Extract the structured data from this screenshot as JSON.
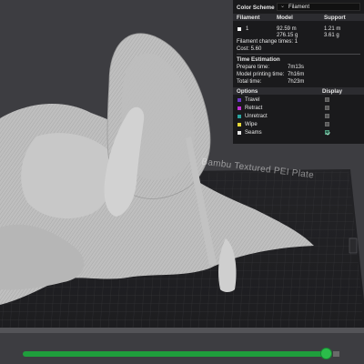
{
  "viewport": {
    "bed_label": "Bambu Textured PEI Plate"
  },
  "panel": {
    "color_scheme_label": "Color Scheme",
    "color_scheme_value": "Filament",
    "filament_table": {
      "headers": [
        "Filament",
        "Model",
        "Support"
      ],
      "rows": [
        {
          "id": "1",
          "model_length": "92.59 m",
          "model_weight": "276.15 g",
          "support_length": "1.21 m",
          "support_weight": "3.61 g",
          "color": "#ffffff"
        }
      ]
    },
    "filament_change_times": "Filament change times:  1",
    "cost": "Cost:  5.60",
    "time_estimation": {
      "title": "Time Estimation",
      "prepare_label": "Prepare time:",
      "prepare_value": "7m13s",
      "printing_label": "Model printing time:",
      "printing_value": "7h16m",
      "total_label": "Total time:",
      "total_value": "7h23m"
    },
    "options": {
      "title": "Options",
      "display_title": "Display",
      "items": [
        {
          "label": "Travel",
          "color": "#6b39c4",
          "checked": false
        },
        {
          "label": "Retract",
          "color": "#c331d6",
          "checked": false
        },
        {
          "label": "Unretract",
          "color": "#2aa4a0",
          "checked": false
        },
        {
          "label": "Wipe",
          "color": "#e7d838",
          "checked": false
        },
        {
          "label": "Seams",
          "color": "#e8e8e8",
          "checked": true
        }
      ]
    }
  },
  "layer_slider": {
    "progress": 1.0,
    "color": "#1f9e3c"
  }
}
